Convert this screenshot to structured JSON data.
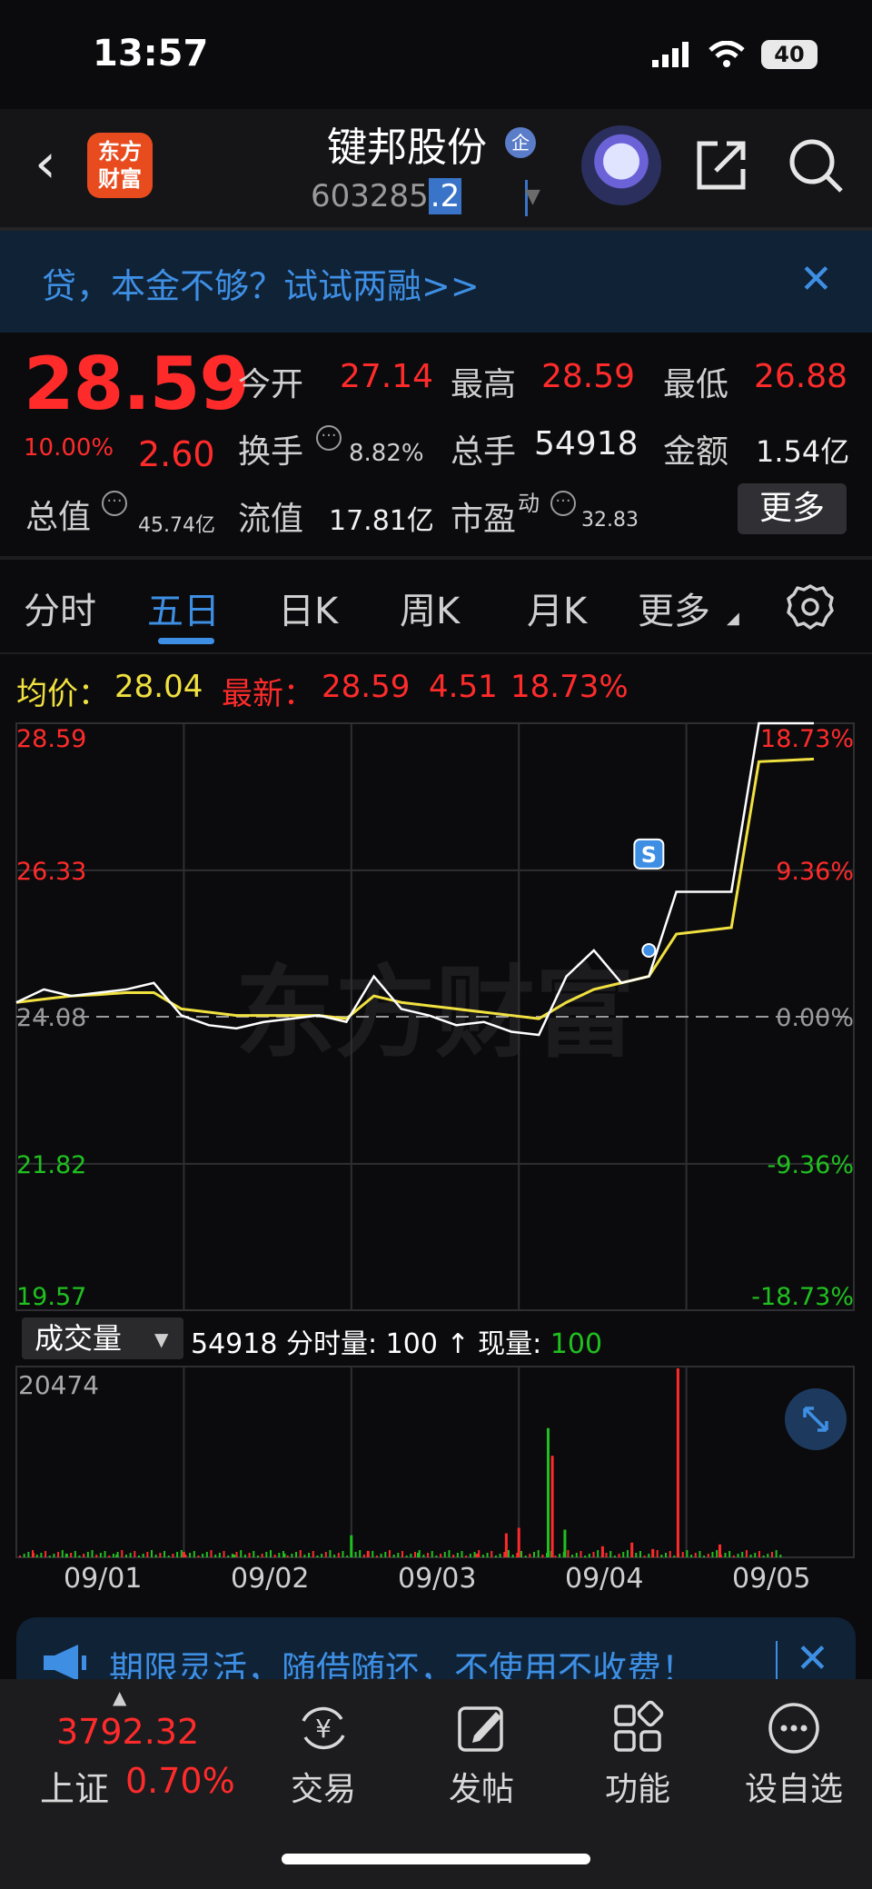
{
  "status": {
    "time": "13:57",
    "battery": "40"
  },
  "header": {
    "stock_name": "键邦股份",
    "badge": "企",
    "code_main": "603285",
    "code_sel": ".2",
    "logo_line1": "东方",
    "logo_line2": "财富"
  },
  "promo": {
    "text": "贷，本金不够？试试两融>>"
  },
  "quote": {
    "price": "28.59",
    "change_pct": "10.00%",
    "change": "2.60",
    "open_label": "今开",
    "open": "27.14",
    "high_label": "最高",
    "high": "28.59",
    "low_label": "最低",
    "low": "26.88",
    "turnover_label": "换手",
    "turnover": "8.82%",
    "volume_label": "总手",
    "volume": "54918",
    "amount_label": "金额",
    "amount": "1.54亿",
    "mktcap_label": "总值",
    "mktcap": "45.74亿",
    "float_label": "流值",
    "float": "17.81亿",
    "pe_label": "市盈",
    "pe_sup": "动",
    "pe": "32.83",
    "more": "更多"
  },
  "tabs": [
    "分时",
    "五日",
    "日K",
    "周K",
    "月K",
    "更多"
  ],
  "info_line": {
    "avg_label": "均价：",
    "avg": "28.04",
    "latest_label": "最新：",
    "latest": "28.59",
    "chg": "4.51",
    "chg_pct": "18.73%"
  },
  "chart_data": {
    "type": "line",
    "title": "",
    "x": [
      "09/01",
      "09/02",
      "09/03",
      "09/04",
      "09/05"
    ],
    "y_left_ticks": [
      "28.59",
      "26.33",
      "24.08",
      "21.82",
      "19.57"
    ],
    "y_right_ticks": [
      "18.73%",
      "9.36%",
      "0.00%",
      "-9.36%",
      "-18.73%"
    ],
    "ylim": [
      19.57,
      28.59
    ],
    "reference_price": 24.08,
    "series": [
      {
        "name": "最新",
        "color": "#ffffff",
        "values": [
          24.3,
          24.5,
          24.4,
          24.45,
          24.5,
          24.6,
          24.1,
          23.95,
          23.9,
          24.0,
          24.05,
          24.1,
          24.0,
          24.7,
          24.2,
          24.1,
          23.95,
          24.0,
          23.85,
          23.8,
          24.7,
          25.1,
          24.6,
          24.7,
          26.0,
          26.0,
          26.0,
          28.59,
          28.59,
          28.59
        ]
      },
      {
        "name": "均价",
        "color": "#f0e040",
        "values": [
          24.3,
          24.35,
          24.4,
          24.42,
          24.45,
          24.45,
          24.2,
          24.15,
          24.1,
          24.1,
          24.1,
          24.1,
          24.05,
          24.4,
          24.3,
          24.25,
          24.2,
          24.15,
          24.1,
          24.05,
          24.3,
          24.5,
          24.6,
          24.7,
          25.35,
          25.4,
          25.45,
          28.0,
          28.02,
          28.04
        ]
      }
    ],
    "signal": "S",
    "volume": {
      "label": "成交量",
      "max_label": "20474",
      "total": "54918",
      "tick_label": "分时量:",
      "tick_val": "100",
      "arrow": "↑",
      "now_label": "现量:",
      "now_val": "100",
      "bars": [
        {
          "x": 0.02,
          "v": 500,
          "c": "#ff2b2b"
        },
        {
          "x": 0.06,
          "v": 400,
          "c": "#20c020"
        },
        {
          "x": 0.12,
          "v": 300,
          "c": "#20c020"
        },
        {
          "x": 0.2,
          "v": 600,
          "c": "#ff2b2b"
        },
        {
          "x": 0.26,
          "v": 300,
          "c": "#20c020"
        },
        {
          "x": 0.32,
          "v": 400,
          "c": "#20c020"
        },
        {
          "x": 0.4,
          "v": 2400,
          "c": "#20c020"
        },
        {
          "x": 0.42,
          "v": 700,
          "c": "#ff2b2b"
        },
        {
          "x": 0.48,
          "v": 500,
          "c": "#20c020"
        },
        {
          "x": 0.55,
          "v": 400,
          "c": "#ff2b2b"
        },
        {
          "x": 0.585,
          "v": 2600,
          "c": "#ff2b2b"
        },
        {
          "x": 0.6,
          "v": 3200,
          "c": "#ff2b2b"
        },
        {
          "x": 0.635,
          "v": 14000,
          "c": "#20c020"
        },
        {
          "x": 0.64,
          "v": 11000,
          "c": "#ff2b2b"
        },
        {
          "x": 0.655,
          "v": 3000,
          "c": "#20c020"
        },
        {
          "x": 0.7,
          "v": 1200,
          "c": "#ff2b2b"
        },
        {
          "x": 0.735,
          "v": 1600,
          "c": "#ff2b2b"
        },
        {
          "x": 0.76,
          "v": 900,
          "c": "#ff2b2b"
        },
        {
          "x": 0.79,
          "v": 20474,
          "c": "#ff2b2b"
        },
        {
          "x": 0.84,
          "v": 1400,
          "c": "#ff2b2b"
        }
      ]
    }
  },
  "banner2": {
    "text": "期限灵活，随借随还，不使用不收费！"
  },
  "index": {
    "name": "上证",
    "value": "3792.32",
    "pct": "0.70%"
  },
  "nav": [
    "交易",
    "发帖",
    "功能",
    "设自选"
  ],
  "watermark": "东方财富"
}
